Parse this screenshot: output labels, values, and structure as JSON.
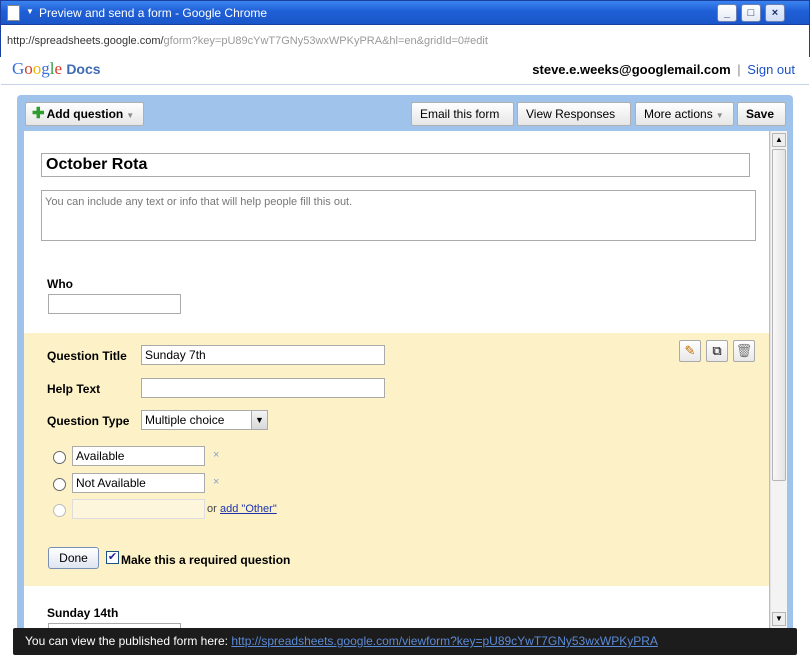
{
  "window": {
    "title": "Preview and send a form - Google Chrome",
    "minimize": "_",
    "maximize": "□",
    "close": "×"
  },
  "address": {
    "host": "http://spreadsheets.google.com/",
    "path": "gform?key=pU89cYwT7GNy53wxWPKyPRA&hl=en&gridId=0#edit"
  },
  "header": {
    "logo_google": "Google",
    "logo_docs": "Docs",
    "user_email": "steve.e.weeks@googlemail.com",
    "separator": "|",
    "sign_out": "Sign out"
  },
  "toolbar": {
    "add_question": "Add question",
    "email_form": "Email this form",
    "view_responses": "View Responses",
    "more_actions": "More actions",
    "save": "Save"
  },
  "form": {
    "title": "October Rota",
    "description_placeholder": "You can include any text or info that will help people fill this out.",
    "q1_title": "Who",
    "editor": {
      "question_title_label": "Question Title",
      "question_title_value": "Sunday 7th",
      "help_text_label": "Help Text",
      "help_text_value": "",
      "question_type_label": "Question Type",
      "question_type_value": "Multiple choice",
      "options": [
        "Available",
        "Not Available"
      ],
      "remove_glyph": "×",
      "or_text": "or",
      "add_other": "add \"Other\"",
      "done": "Done",
      "required_label": "Make this a required question",
      "required_checked": true
    },
    "q3_title": "Sunday 14th"
  },
  "status": {
    "prefix": "You can view the published form here:",
    "link": "http://spreadsheets.google.com/viewform?key=pU89cYwT7GNy53wxWPKyPRA"
  }
}
